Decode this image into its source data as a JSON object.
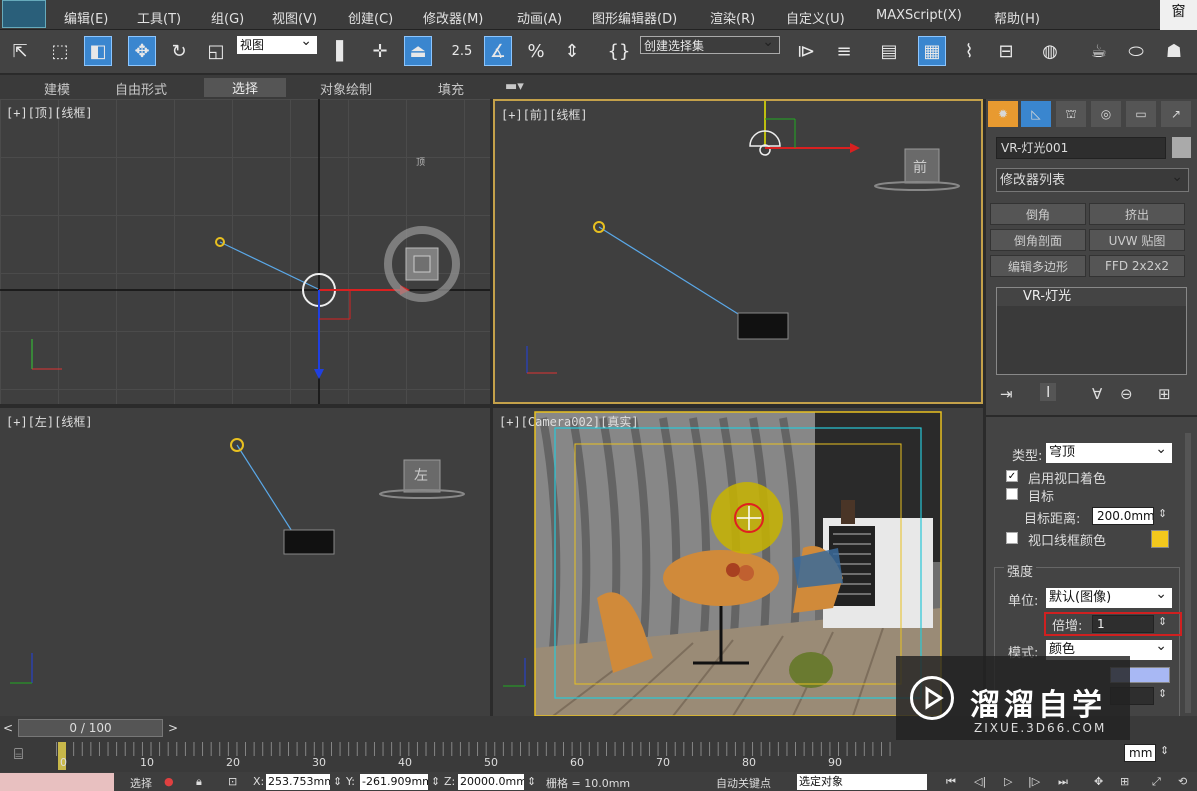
{
  "menu": [
    "编辑(E)",
    "工具(T)",
    "组(G)",
    "视图(V)",
    "创建(C)",
    "修改器(M)",
    "动画(A)",
    "图形编辑器(D)",
    "渲染(R)",
    "自定义(U)",
    "MAXScript(X)",
    "帮助(H)"
  ],
  "window_corner": "窗",
  "toolbar": {
    "view_dropdown": "视图",
    "snap_25": "2.5",
    "selection_set": "创建选择集"
  },
  "ribbon_tabs": [
    "建模",
    "自由形式",
    "选择",
    "对象绘制",
    "填充"
  ],
  "viewports": {
    "top": "[+][顶][线框]",
    "front": "[+][前][线框]",
    "left": "[+][左][线框]",
    "camera": "[+][Camera002][真实]",
    "cube_front": "前",
    "cube_left": "左",
    "cube_top": "顶"
  },
  "cmd": {
    "object_name": "VR-灯光001",
    "modifier_list": "修改器列表",
    "buttons": [
      "倒角",
      "挤出",
      "倒角剖面",
      "UVW 贴图",
      "编辑多边形",
      "FFD 2x2x2"
    ],
    "stack_item": "VR-灯光",
    "type_label": "类型:",
    "type_value": "穹顶",
    "enable_viewport_shading": "启用视口着色",
    "target": "目标",
    "target_distance_label": "目标距离:",
    "target_distance": "200.0mm",
    "viewport_wire_color": "视口线框颜色",
    "intensity_group": "强度",
    "unit_label": "单位:",
    "unit_value": "默认(图像)",
    "multiplier_label": "倍增:",
    "multiplier_value": "1",
    "mode_label": "模式:",
    "mode_value": "颜色",
    "mm_value": "mm",
    "wire_color": "#f2c81e",
    "light_color": "#a8b8f4"
  },
  "trackbar": {
    "frame": "0 / 100"
  },
  "timeline": {
    "ticks": [
      "0",
      "10",
      "20",
      "30",
      "40",
      "50",
      "60",
      "70",
      "80",
      "90"
    ]
  },
  "status": {
    "x_label": "X:",
    "x": "253.753mm",
    "y_label": "Y:",
    "y": "-261.909mm",
    "z_label": "Z:",
    "z": "20000.0mm",
    "grid": "栅格 = 10.0mm",
    "autokey": "自动关键点",
    "selected": "选定对象",
    "misc": "选择"
  },
  "watermark": {
    "title": "溜溜自学",
    "url": "ZIXUE.3D66.COM"
  }
}
